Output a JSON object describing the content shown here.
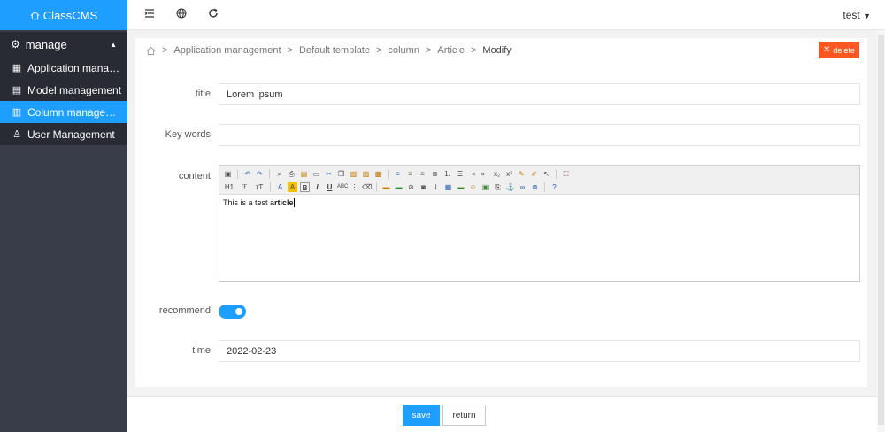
{
  "app": {
    "logo": "ClassCMS"
  },
  "sidebar": {
    "group_label": "manage",
    "items": [
      {
        "label": "Application manage…",
        "icon": "app-icon"
      },
      {
        "label": "Model management",
        "icon": "model-icon"
      },
      {
        "label": "Column management",
        "icon": "column-icon",
        "active": true
      },
      {
        "label": "User Management",
        "icon": "user-icon"
      }
    ]
  },
  "header": {
    "user": "test"
  },
  "breadcrumb": {
    "items": [
      "Application management",
      "Default template",
      "column",
      "Article"
    ],
    "current": "Modify",
    "separator": ">"
  },
  "actions": {
    "delete_label": "delete"
  },
  "form": {
    "title_label": "title",
    "title_value": "Lorem ipsum",
    "keywords_label": "Key words",
    "keywords_value": "",
    "content_label": "content",
    "content_text_plain": "This is a test a",
    "content_text_bold": "rticle",
    "recommend_label": "recommend",
    "recommend_on": true,
    "time_label": "time",
    "time_value": "2022-02-23"
  },
  "footer": {
    "save_label": "save",
    "return_label": "return"
  },
  "colors": {
    "accent": "#1E9FFF",
    "danger": "#FF5722",
    "sidebar": "#393d49",
    "sidebar_dark": "#282b33"
  }
}
